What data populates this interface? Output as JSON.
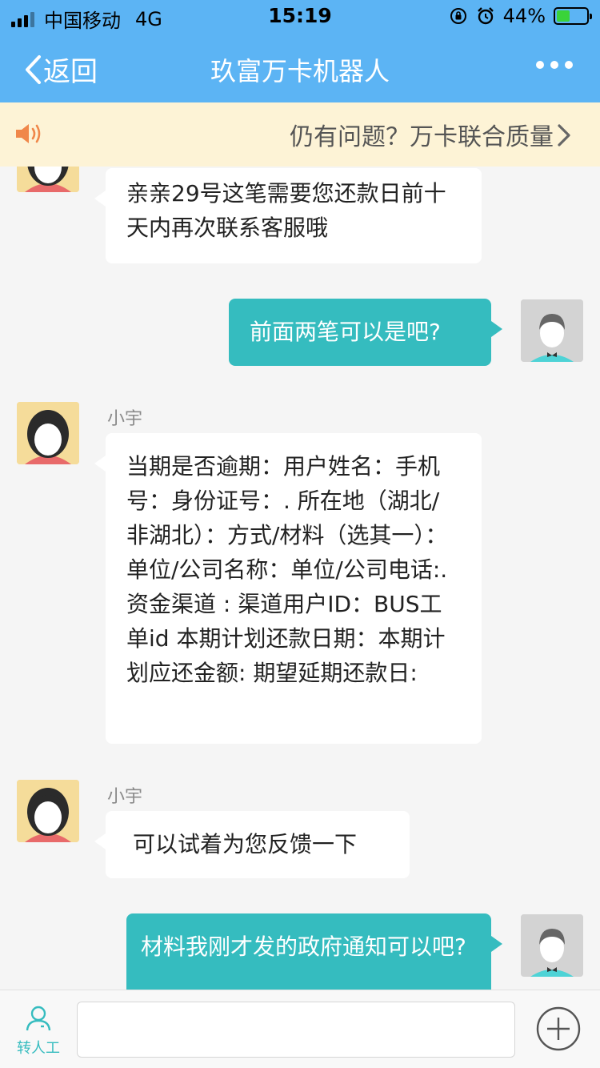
{
  "status_bar": {
    "carrier": "中国移动",
    "network": "4G",
    "time": "15:19",
    "battery": "44%",
    "battery_level": 0.44
  },
  "nav": {
    "back_label": "返回",
    "title": "玖富万卡机器人"
  },
  "notice": {
    "text": "仍有问题？万卡联合质量"
  },
  "messages": [
    {
      "side": "left",
      "sender": "",
      "text": "亲亲29号这笔需要您还款日前十天内再次联系客服哦"
    },
    {
      "side": "right",
      "text": "前面两笔可以是吧?"
    },
    {
      "side": "left",
      "sender": "小宇",
      "text": "当期是否逾期：用户姓名：手机号：身份证号：.  所在地（湖北/非湖北）：方式/材料（选其一）：单位/公司名称：单位/公司电话:.  资金渠道 :  渠道用户ID：BUS工单id   本期计划还款日期：本期计划应还金额: 期望延期还款日:"
    },
    {
      "side": "left",
      "sender": "小宇",
      "text": "可以试着为您反馈一下"
    },
    {
      "side": "right",
      "text": "材料我刚才发的政府通知可以吧?"
    }
  ],
  "bottom": {
    "human_label": "转人工",
    "input_value": "",
    "input_placeholder": ""
  },
  "colors": {
    "header": "#5cb4f4",
    "accent": "#35bcbf",
    "notice_bg": "#fdf3d6",
    "speaker": "#f0874a"
  },
  "icons": [
    "back-chevron-icon",
    "more-icon",
    "speaker-icon",
    "chevron-right-icon",
    "person-icon",
    "plus-circle-icon"
  ]
}
